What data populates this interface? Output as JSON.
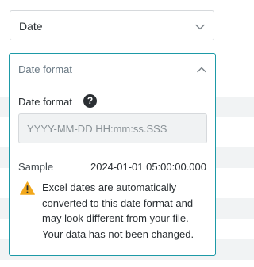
{
  "type_select": {
    "value": "Date",
    "icon": "chevron-down-icon"
  },
  "date_format_panel": {
    "title": "Date format",
    "collapse_icon": "chevron-up-icon",
    "field_label": "Date format",
    "help_icon": "question-circle-icon",
    "help_glyph": "?",
    "input_placeholder": "YYYY-MM-DD HH:mm:ss.SSS",
    "input_value": "",
    "sample_label": "Sample",
    "sample_value": "2024-01-01 05:00:00.000",
    "warning_icon": "warning-triangle-icon",
    "warning_text": "Excel dates are automatically converted to this date format and may look different from your file. Your data has not been changed."
  },
  "colors": {
    "accent_border": "#1d9aa7",
    "warning_fill": "#f2a81d",
    "background_stripe": "#f1f3f4"
  }
}
